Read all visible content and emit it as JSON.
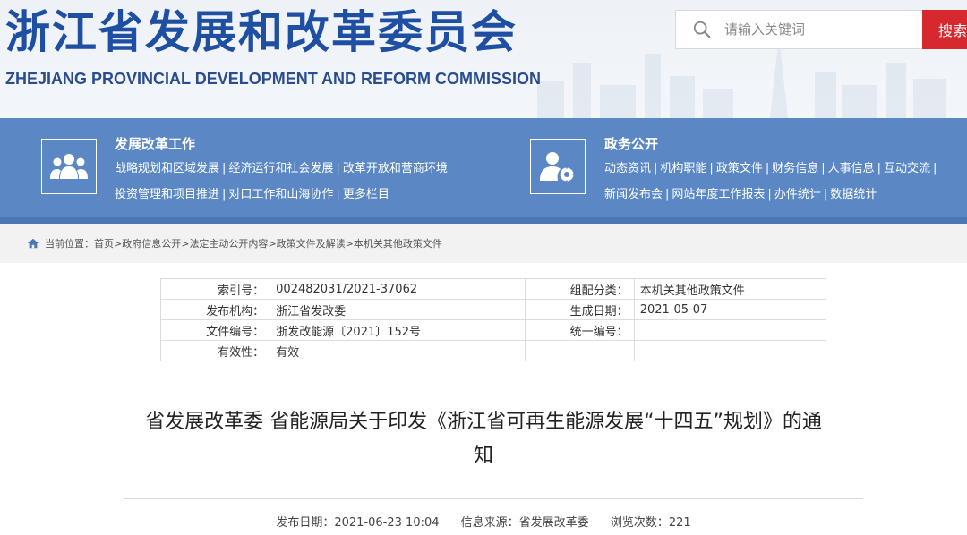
{
  "header": {
    "title": "浙江省发展和改革委员会",
    "subtitle": "ZHEJIANG PROVINCIAL DEVELOPMENT AND REFORM COMMISSION",
    "search_placeholder": "请输入关键词",
    "search_button": "搜索"
  },
  "nav": {
    "group1": {
      "heading": "发展改革工作",
      "links_row1": [
        "战略规划和区域发展",
        "经济运行和社会发展",
        "改革开放和营商环境"
      ],
      "links_row2": [
        "投资管理和项目推进",
        "对口工作和山海协作",
        "更多栏目"
      ]
    },
    "group2": {
      "heading": "政务公开",
      "links_row1": [
        "动态资讯",
        "机构职能",
        "政策文件",
        "财务信息",
        "人事信息",
        "互动交流"
      ],
      "links_row2": [
        "新闻发布会",
        "网站年度工作报表",
        "办件统计",
        "数据统计"
      ]
    }
  },
  "breadcrumb": {
    "label": "当前位置：",
    "items": [
      "首页",
      "政府信息公开",
      "法定主动公开内容",
      "政策文件及解读",
      "本机关其他政策文件"
    ],
    "separator": ">"
  },
  "meta": {
    "rows": [
      {
        "l1": "索引号：",
        "v1": "002482031/2021-37062",
        "l2": "组配分类：",
        "v2": "本机关其他政策文件"
      },
      {
        "l1": "发布机构：",
        "v1": "浙江省发改委",
        "l2": "生成日期：",
        "v2": "2021-05-07"
      },
      {
        "l1": "文件编号：",
        "v1": "浙发改能源〔2021〕152号",
        "l2": "统一编号：",
        "v2": ""
      },
      {
        "l1": "有效性：",
        "v1": "有效",
        "l2": "",
        "v2": ""
      }
    ]
  },
  "article": {
    "title_line1": "省发展改革委 省能源局关于印发《浙江省可再生能源发展“十四五”规划》的通",
    "title_line2": "知",
    "publish_date": "发布日期：2021-06-23 10:04",
    "source": "信息来源：省发展改革委",
    "views": "浏览次数：221"
  },
  "colors": {
    "brand_blue": "#1e4fa3",
    "nav_blue": "#5b88c5",
    "search_red": "#d7282f"
  }
}
